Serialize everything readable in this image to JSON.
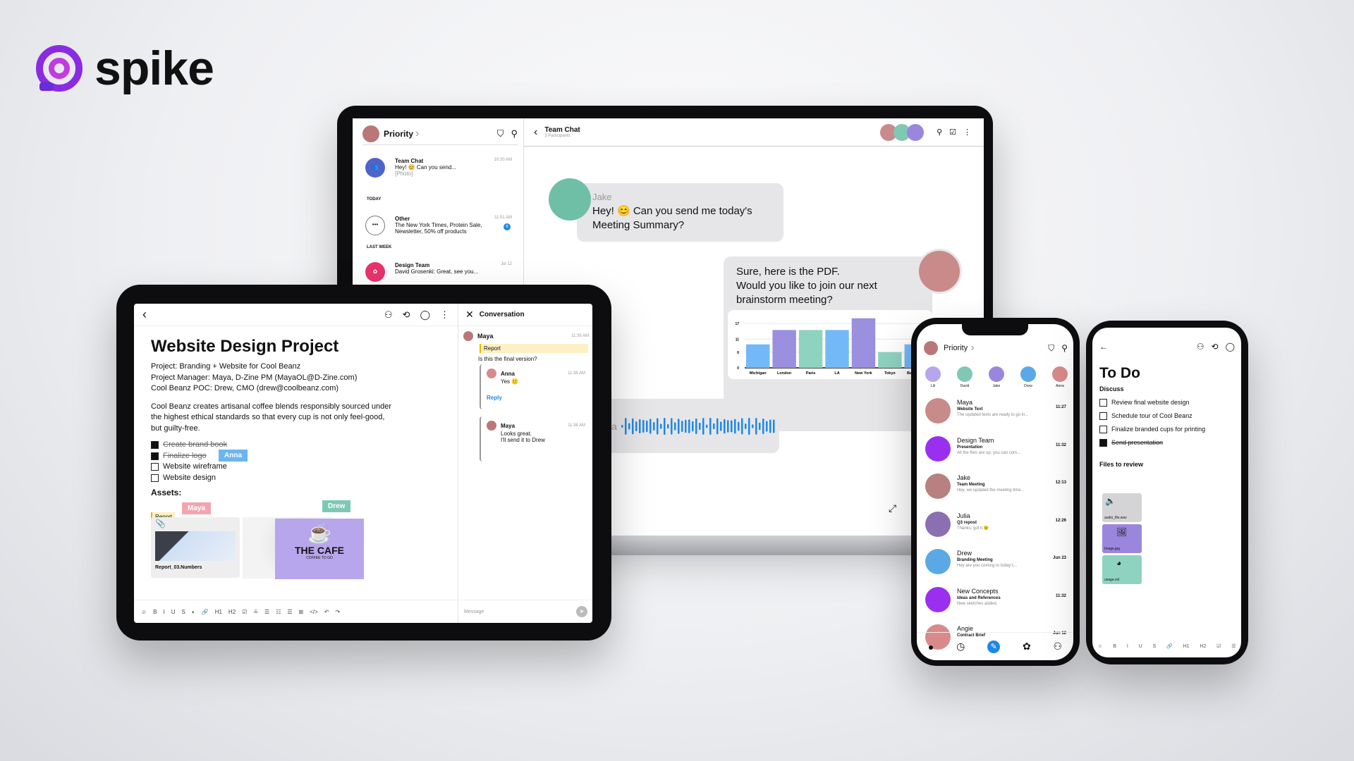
{
  "brand": {
    "name": "spike",
    "color": "#8a2be2"
  },
  "laptop": {
    "sidebar": {
      "title": "Priority",
      "items": [
        {
          "name": "Team Chat",
          "preview": "Hey! 😊 Can you send...",
          "sub": "[Photo]",
          "time": "10:20 AM",
          "icon": "people-icon",
          "color": "#4f63c9"
        },
        {
          "section": "TODAY"
        },
        {
          "name": "Other",
          "preview": "The New York Times, Protein Sale,",
          "preview2": "Newsletter, 50% off products",
          "time": "11:01 AM",
          "badge": "6",
          "icon": "more-icon"
        },
        {
          "section": "LAST WEEK"
        },
        {
          "name": "Design Team",
          "preview": "David Grosenki: Great, see you...",
          "time": "Jul 12",
          "icon": "flower-icon",
          "color": "#e8336d"
        }
      ]
    },
    "chat": {
      "title": "Team Chat",
      "subtitle": "3 Participants",
      "msg1": {
        "sender": "Jake",
        "line1": "Hey! 😊 Can you send me today's",
        "line2": "Meeting Summary?"
      },
      "msg2": {
        "line1": "Sure, here is the PDF.",
        "line2": "Would you like to join our next",
        "line3": "brainstorm meeting?"
      },
      "audio_prefix": "a"
    }
  },
  "chart_data": {
    "type": "bar",
    "categories": [
      "Michigan",
      "London",
      "Paris",
      "LA",
      "New York",
      "Tokyo",
      "Barcelona"
    ],
    "values": [
      9,
      14.5,
      14.5,
      14.5,
      19,
      6,
      9
    ],
    "colors": [
      "#74b9f7",
      "#9b8fe0",
      "#8ed3bf",
      "#74b9f7",
      "#9b8fe0",
      "#8ed3bf",
      "#74b9f7"
    ],
    "yticks": [
      0,
      6,
      11,
      17
    ],
    "ylim": [
      0,
      20
    ],
    "grid": true
  },
  "tablet": {
    "title": "Website Design Project",
    "info": [
      "Project: Branding + Website for Cool Beanz",
      "Project Manager: Maya, D-Zine PM (MayaOL@D-Zine.com)",
      "Cool Beanz POC: Drew, CMO (drew@coolbeanz.com)"
    ],
    "desc": [
      "Cool Beanz creates artisanal coffee blends responsibly sourced under",
      "the highest ethical standards so that every cup is not only feel-good,",
      "but guilty-free."
    ],
    "tasks": [
      {
        "label": "Create brand book",
        "done": true
      },
      {
        "label": "Finalize logo",
        "done": true
      },
      {
        "label": "Website wireframe",
        "done": false
      },
      {
        "label": "Website design",
        "done": false
      }
    ],
    "assets_label": "Assets:",
    "report_tag": "Report",
    "file_name": "Report_03.Numbers",
    "cafe_logo": "THE CAFE",
    "cafe_sub": "COFFEE TO GO",
    "cursors": {
      "anna": "Anna",
      "maya": "Maya",
      "drew": "Drew"
    },
    "toolbar": [
      "☺",
      "B",
      "I",
      "U",
      "S",
      "◐",
      "🔗",
      "H1",
      "H2",
      "☑",
      "≟",
      "☰",
      "☷",
      "☰",
      "⊞",
      "</>",
      "↶",
      "↷"
    ],
    "conversation": {
      "title": "Conversation",
      "msg": {
        "sender": "Maya",
        "time": "11:35 AM",
        "quote": "Report",
        "text": "Is this the final version?"
      },
      "replies": [
        {
          "sender": "Anna",
          "time": "11:38 AM",
          "lines": [
            "Yes 🙂"
          ]
        },
        {
          "sender": "Maya",
          "time": "11:38 AM",
          "lines": [
            "Looks great.",
            "I'll send it to Drew"
          ]
        }
      ],
      "reply_label": "Reply",
      "message_placeholder": "Message"
    }
  },
  "phone1": {
    "title": "Priority",
    "stories": [
      "Lili",
      "David",
      "Jake",
      "Drew",
      "Anna"
    ],
    "items": [
      {
        "name": "Maya",
        "subject": "Website Text",
        "preview": "The updated texts are ready to go in...",
        "time": "11:27",
        "color": "#c98a8a"
      },
      {
        "name": "Design Team",
        "subject": "Presentation",
        "preview": "All the files are up, you can com...",
        "time": "11:32",
        "color": "#9b2ff0"
      },
      {
        "name": "Jake",
        "subject": "Team Meeting",
        "preview": "Hey, we updated the meeting time...",
        "time": "12:13",
        "color": "#b88080"
      },
      {
        "name": "Julia",
        "subject": "Q3 repost",
        "preview": "Thanks, got it 😉",
        "time": "12:26",
        "color": "#8b6fb0"
      },
      {
        "name": "Drew",
        "subject": "Branding Meeting",
        "preview": "Hey are you coming to today's...",
        "time": "Jun 23",
        "color": "#5aa8e6"
      },
      {
        "name": "New Concepts",
        "subject": "Ideas and References",
        "preview": "New sketches added.",
        "time": "11:32",
        "color": "#9b2ff0"
      },
      {
        "name": "Angie",
        "subject": "Contract Brief",
        "preview": "",
        "time": "Jun 12",
        "color": "#d88a8a"
      }
    ]
  },
  "phone2": {
    "title": "To Do",
    "section1": "Discuss",
    "tasks": [
      {
        "label": "Review final website design",
        "done": false
      },
      {
        "label": "Schedule tour of Cool Beanz",
        "done": false
      },
      {
        "label": "Finalize branded cups for printing",
        "done": false
      },
      {
        "label": "Send presentation",
        "done": true
      }
    ],
    "section2": "Files to review",
    "files": [
      {
        "name": "audio_file.wav",
        "color": "#d4d4d6",
        "icon": "speaker-icon"
      },
      {
        "name": "Image.jpg",
        "color": "#9b86dd",
        "icon": "image-icon"
      },
      {
        "name": "usage.exl",
        "color": "#8ed3bf",
        "icon": "pie-chart-icon"
      }
    ],
    "toolbar": [
      "☺",
      "B",
      "I",
      "U",
      "S",
      "🔗",
      "H1",
      "H2",
      "☑",
      "☰"
    ]
  }
}
